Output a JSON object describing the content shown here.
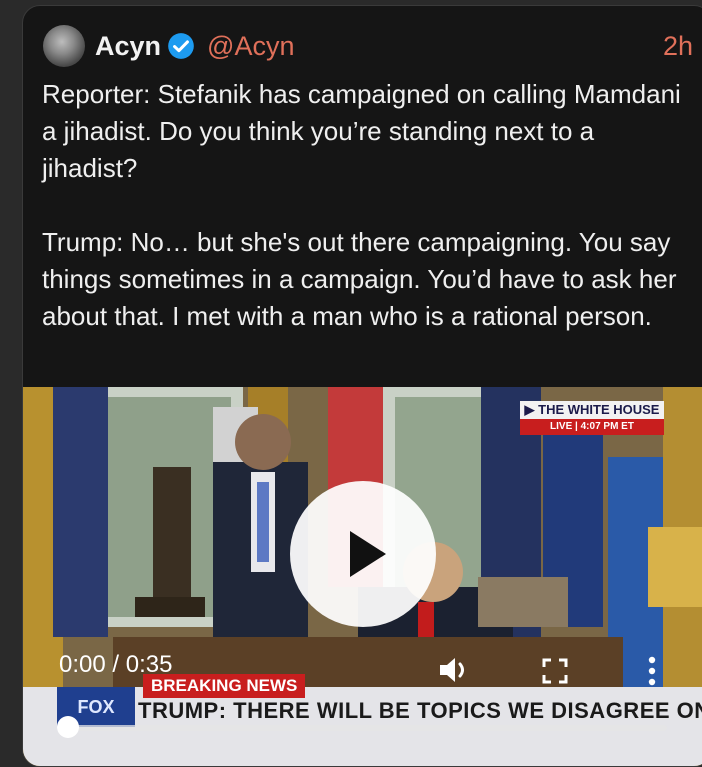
{
  "post": {
    "display_name": "Acyn",
    "handle": "@Acyn",
    "timestamp": "2h",
    "paragraph_1": "Reporter: Stefanik has campaigned on calling Mamdani a jihadist. Do you think you’re standing next to a jihadist?",
    "paragraph_2": "Trump: No… but she's out there campaigning. You say things sometimes in a campaign. You’d have to ask her about that. I met with a man who is a rational person."
  },
  "video": {
    "time_display": "0:00 / 0:35",
    "progress": 0.0,
    "overlay": {
      "network_bug": "FOX",
      "breaking_label": "BREAKING NEWS",
      "headline": "TRUMP: THERE WILL BE TOPICS WE DISAGREE ON",
      "location_title": "▶ THE WHITE HOUSE",
      "live_label": "LIVE  |  4:07 PM ET"
    }
  },
  "icons": {
    "verified": "verified-badge-icon",
    "play": "play-icon",
    "volume": "volume-icon",
    "fullscreen": "fullscreen-icon",
    "more": "more-vertical-icon"
  },
  "colors": {
    "accent": "#e0705a",
    "verified": "#1d9bf0",
    "card_bg": "#151515",
    "text": "#efefef"
  }
}
